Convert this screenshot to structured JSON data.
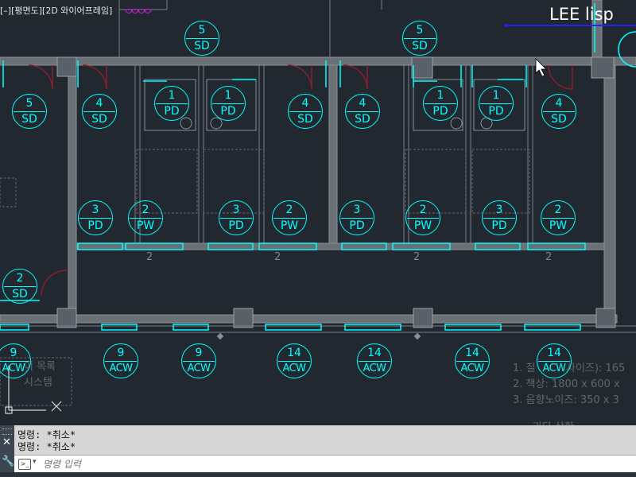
{
  "viewport_label": "[–][평면도][2D 와이어프레임]",
  "plugin_label": "LEE lisp",
  "tags": [
    {
      "num": "5",
      "code": "SD"
    },
    {
      "num": "5",
      "code": "SD"
    },
    {
      "num": "5",
      "code": "SD"
    },
    {
      "num": "4",
      "code": "SD"
    },
    {
      "num": "1",
      "code": "PD"
    },
    {
      "num": "1",
      "code": "PD"
    },
    {
      "num": "4",
      "code": "SD"
    },
    {
      "num": "4",
      "code": "SD"
    },
    {
      "num": "1",
      "code": "PD"
    },
    {
      "num": "1",
      "code": "PD"
    },
    {
      "num": "4",
      "code": "SD"
    },
    {
      "num": "3",
      "code": "PD"
    },
    {
      "num": "2",
      "code": "PW"
    },
    {
      "num": "3",
      "code": "PD"
    },
    {
      "num": "2",
      "code": "PW"
    },
    {
      "num": "3",
      "code": "PD"
    },
    {
      "num": "2",
      "code": "PW"
    },
    {
      "num": "3",
      "code": "PD"
    },
    {
      "num": "2",
      "code": "PW"
    },
    {
      "num": "2",
      "code": "SD"
    },
    {
      "num": "9",
      "code": "ACW"
    },
    {
      "num": "9",
      "code": "ACW"
    },
    {
      "num": "9",
      "code": "ACW"
    },
    {
      "num": "14",
      "code": "ACW"
    },
    {
      "num": "14",
      "code": "ACW"
    },
    {
      "num": "14",
      "code": "ACW"
    },
    {
      "num": "14",
      "code": "ACW"
    }
  ],
  "room_labels": [
    "2",
    "2",
    "2",
    "2"
  ],
  "left_notes": [
    "이 목록",
    "시스템"
  ],
  "right_notes": [
    "1. 칠",
    "사이즈): 165",
    "2. 책상: 1800 x 600 x",
    "3. 음향노이즈: 350 x 3",
    "과다 상한"
  ],
  "command": {
    "history": [
      "명령: *취소*",
      "명령: *취소*"
    ],
    "placeholder": "명령 입력"
  }
}
